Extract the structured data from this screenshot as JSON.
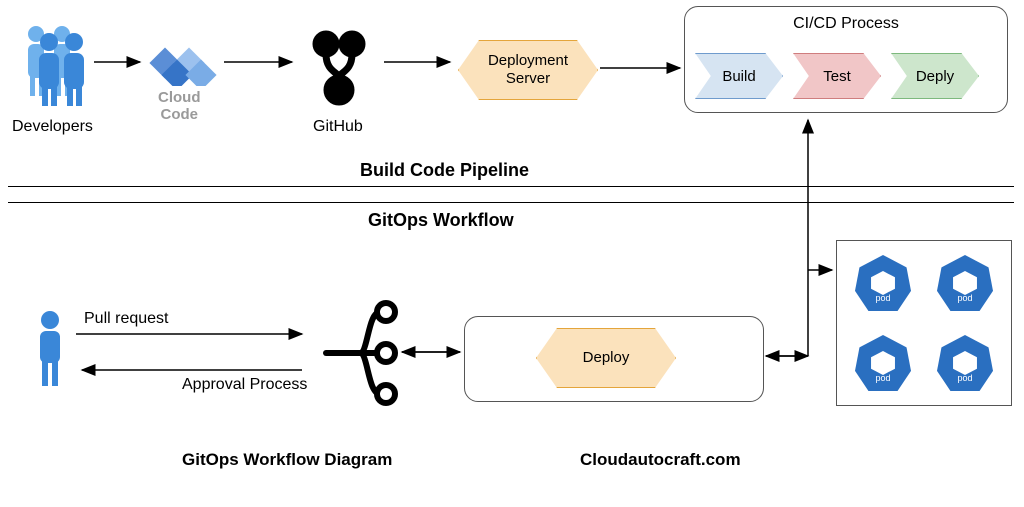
{
  "top": {
    "developers_label": "Developers",
    "cloud_code_line1": "Cloud",
    "cloud_code_line2": "Code",
    "github_label": "GitHub",
    "deployment_server": "Deployment\nServer",
    "cicd_title": "CI/CD Process",
    "steps": {
      "build": "Build",
      "test": "Test",
      "deply": "Deply"
    }
  },
  "dividers": {
    "build_pipeline": "Build  Code Pipeline",
    "gitops_workflow": "GitOps Workflow"
  },
  "bottom": {
    "pull_request": "Pull request",
    "approval_process": "Approval Process",
    "deploy": "Deploy",
    "pod_text": "pod"
  },
  "footer": {
    "left": "GitOps Workflow Diagram",
    "right": "Cloudautocraft.com"
  }
}
